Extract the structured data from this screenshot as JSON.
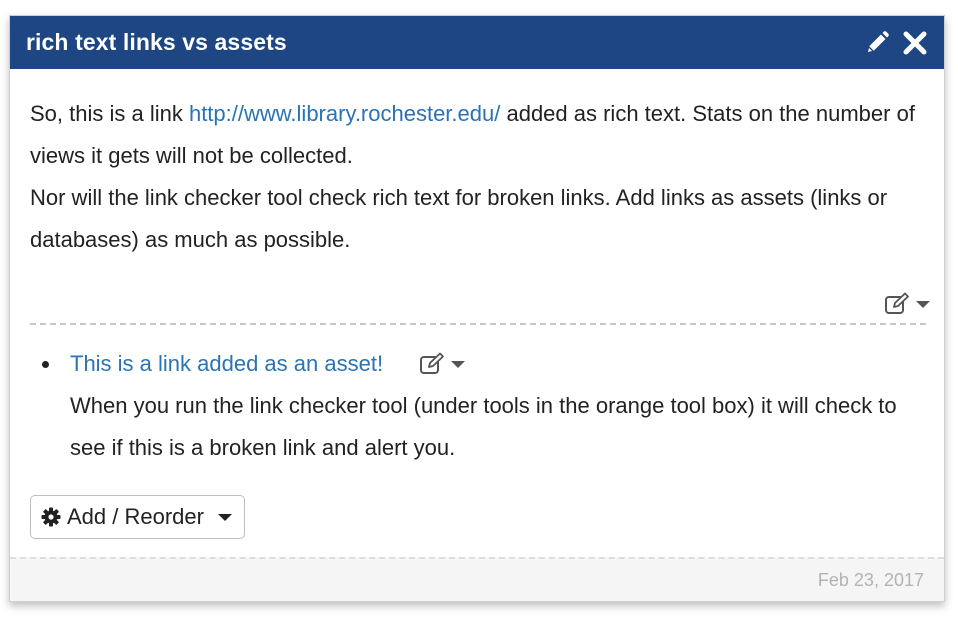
{
  "box": {
    "title": "rich text links vs assets",
    "edit_icon": "pencil-icon",
    "close_icon": "close-icon",
    "header_color": "#1d4682"
  },
  "richtext": {
    "line1_before": "So, this is a link ",
    "link_text": "http://www.library.rochester.edu/",
    "line1_after": " added as rich text.  Stats on the number of views it gets will not be collected.",
    "line2": "Nor will the link checker tool check rich text for broken links.  Add links as assets (links or databases) as much as possible.",
    "link_color": "#2a73b5"
  },
  "asset": {
    "link_text": "This is a link added as an asset!",
    "description": "When you run the link checker tool (under tools in the orange tool box) it will check to see if this is a broken link and alert you."
  },
  "add_reorder": {
    "label": "Add / Reorder",
    "icon": "gear-icon"
  },
  "footer": {
    "date": "Feb 23, 2017"
  }
}
